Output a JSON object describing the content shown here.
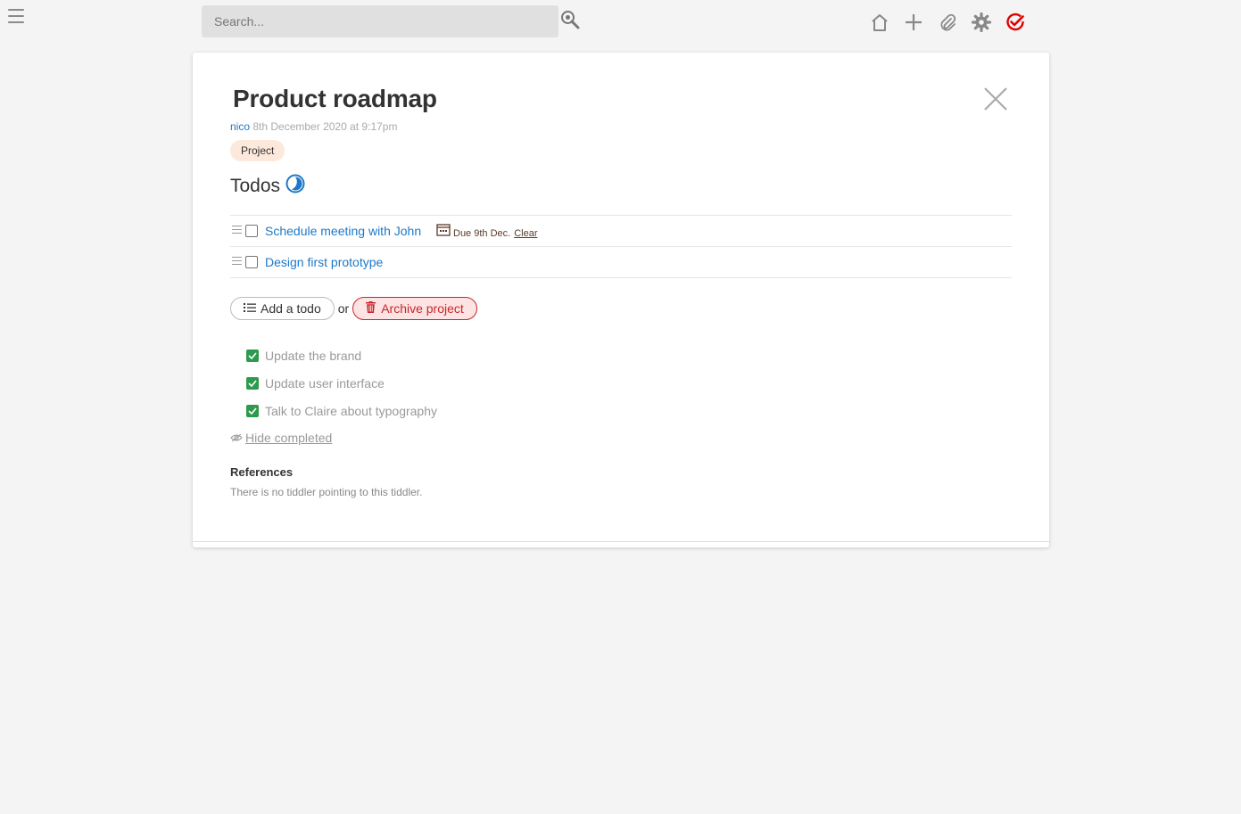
{
  "search": {
    "placeholder": "Search..."
  },
  "toolbar": {
    "icons": [
      "home-icon",
      "plus-icon",
      "paperclip-icon",
      "gear-icon",
      "check-circle-icon"
    ],
    "accent_color": "#e00000"
  },
  "tiddler": {
    "title": "Product roadmap",
    "author": "nico",
    "date": "8th December 2020 at 9:17pm",
    "tag": "Project",
    "todos_heading": "Todos",
    "todos": [
      {
        "label": "Schedule meeting with John",
        "due": "Due 9th Dec.",
        "clear": "Clear"
      },
      {
        "label": "Design first prototype"
      }
    ],
    "add_todo_label": "Add a todo",
    "or_text": "or",
    "archive_label": "Archive project",
    "completed": [
      "Update the brand",
      "Update user interface",
      "Talk to Claire about typography"
    ],
    "hide_completed_label": "Hide completed",
    "references_heading": "References",
    "references_text": "There is no tiddler pointing to this tiddler."
  },
  "colors": {
    "link": "#1e78c8",
    "archive": "#c62828",
    "done_check": "#2e9a4e",
    "tag_bg": "#fde9dc"
  }
}
